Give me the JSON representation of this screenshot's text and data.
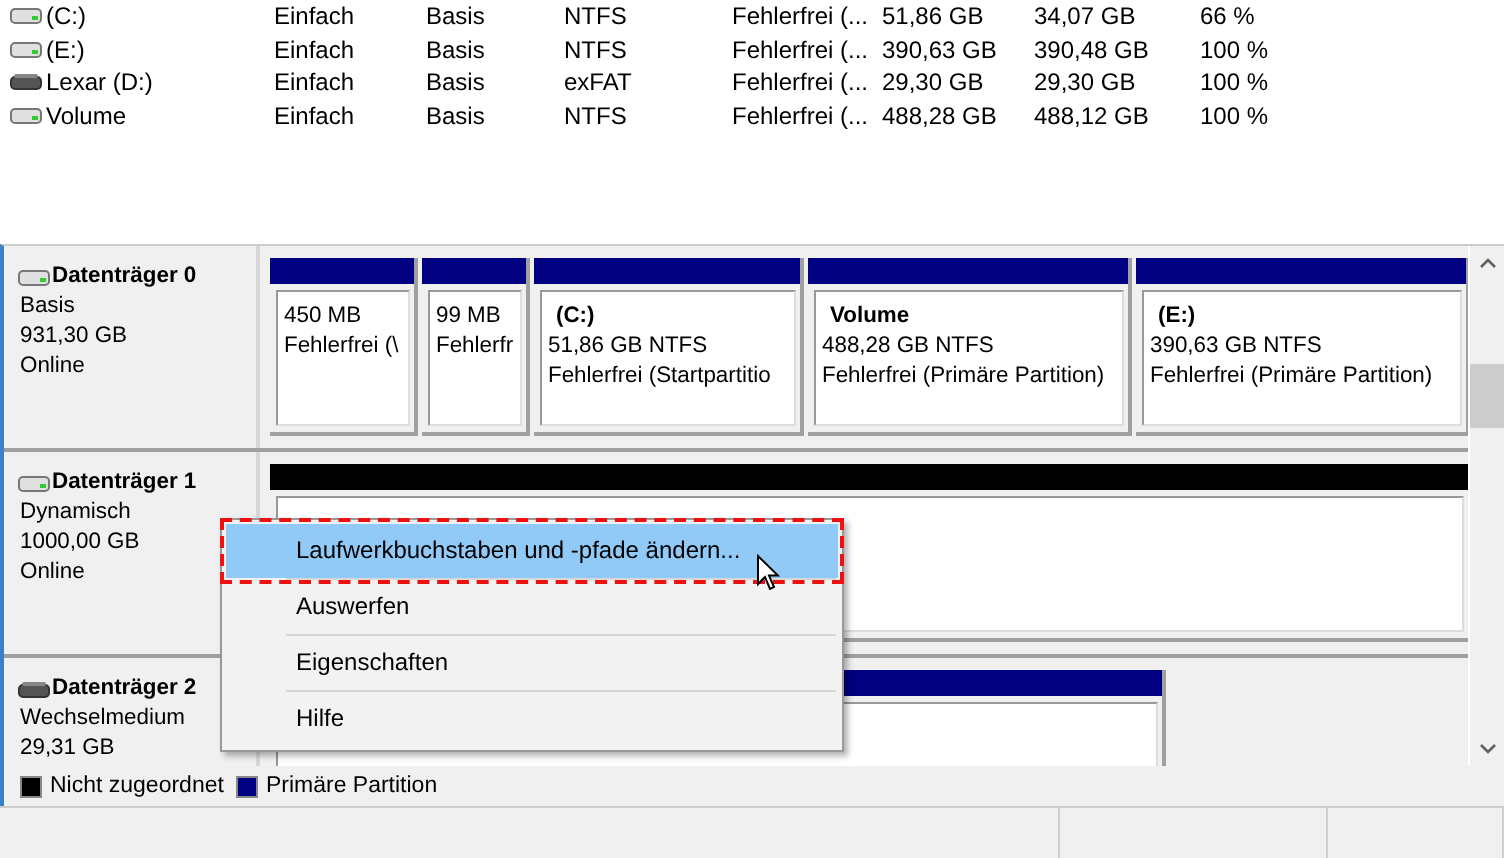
{
  "volumes": [
    {
      "kind": "fixed",
      "name": "(C:)",
      "layout": "Einfach",
      "type": "Basis",
      "fs": "NTFS",
      "status": "Fehlerfrei (...",
      "capacity": "51,86 GB",
      "free": "34,07 GB",
      "free_pct": "66 %"
    },
    {
      "kind": "fixed",
      "name": "(E:)",
      "layout": "Einfach",
      "type": "Basis",
      "fs": "NTFS",
      "status": "Fehlerfrei (...",
      "capacity": "390,63 GB",
      "free": "390,48 GB",
      "free_pct": "100 %"
    },
    {
      "kind": "removable",
      "name": "Lexar (D:)",
      "layout": "Einfach",
      "type": "Basis",
      "fs": "exFAT",
      "status": "Fehlerfrei (...",
      "capacity": "29,30 GB",
      "free": "29,30 GB",
      "free_pct": "100 %"
    },
    {
      "kind": "fixed",
      "name": "Volume",
      "layout": "Einfach",
      "type": "Basis",
      "fs": "NTFS",
      "status": "Fehlerfrei (...",
      "capacity": "488,28 GB",
      "free": "488,12 GB",
      "free_pct": "100 %"
    }
  ],
  "disks": [
    {
      "kind": "fixed",
      "name": "Datenträger 0",
      "lines": [
        "Basis",
        "931,30 GB",
        "Online"
      ],
      "partitions": [
        {
          "kind": "primary",
          "size": "450 MB",
          "status": "Fehlerfrei (\\"
        },
        {
          "kind": "primary",
          "size": "99 MB",
          "status": "Fehlerfr"
        },
        {
          "kind": "primary",
          "title": "(C:)",
          "size": "51,86 GB NTFS",
          "status": "Fehlerfrei (Startpartitio"
        },
        {
          "kind": "primary",
          "title": "Volume",
          "size": "488,28 GB NTFS",
          "status": "Fehlerfrei (Primäre Partition)"
        },
        {
          "kind": "primary",
          "title": "(E:)",
          "size": "390,63 GB NTFS",
          "status": "Fehlerfrei (Primäre Partition)"
        }
      ]
    },
    {
      "kind": "fixed",
      "name": "Datenträger 1",
      "lines": [
        "Dynamisch",
        "1000,00 GB",
        "Online"
      ],
      "partitions": [
        {
          "kind": "unallocated"
        }
      ]
    },
    {
      "kind": "removable",
      "name": "Datenträger 2",
      "lines": [
        "Wechselmedium",
        "29,31 GB"
      ],
      "partitions": [
        {
          "kind": "primary"
        }
      ]
    }
  ],
  "context_menu": [
    {
      "label": "Laufwerkbuchstaben und -pfade ändern...",
      "selected": true
    },
    {
      "label": "Auswerfen",
      "selected": false
    },
    {
      "label": "Eigenschaften",
      "selected": false
    },
    {
      "label": "Hilfe",
      "selected": false
    }
  ],
  "legend": [
    {
      "label": "Nicht zugeordnet",
      "color": "#000000"
    },
    {
      "label": "Primäre Partition",
      "color": "#000080"
    }
  ]
}
